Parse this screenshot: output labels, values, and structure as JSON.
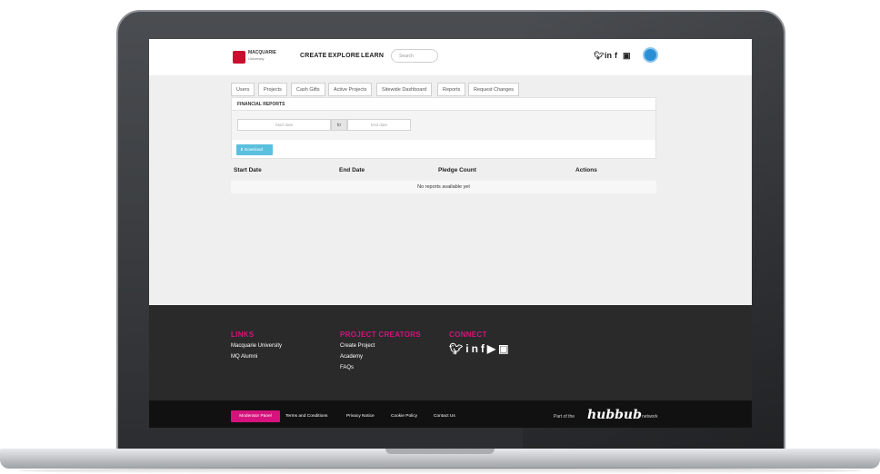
{
  "header": {
    "logo_name": "MACQUARIE",
    "logo_sub": "University",
    "nav": [
      "CREATE",
      "EXPLORE",
      "LEARN"
    ],
    "search_placeholder": "Search",
    "social_icons": [
      "twitter-icon",
      "linkedin-icon",
      "facebook-icon",
      "instagram-icon"
    ]
  },
  "tabs": [
    "Users",
    "Projects",
    "Cash Gifts",
    "Active Projects",
    "Sitewide Dashboard",
    "Reports",
    "Request Changes"
  ],
  "panel": {
    "title": "FINANCIAL REPORTS",
    "start_placeholder": "Start date",
    "to_label": "to",
    "end_placeholder": "End date",
    "download_label": "⬇ Download"
  },
  "table": {
    "headers": [
      "Start Date",
      "End Date",
      "Pledge Count",
      "Actions"
    ],
    "empty_message": "No reports available yet"
  },
  "footer": {
    "links_heading": "LINKS",
    "links": [
      "Macquarie University",
      "MQ Alumni"
    ],
    "creators_heading": "PROJECT CREATORS",
    "creators": [
      "Create Project",
      "Academy",
      "FAQs"
    ],
    "connect_heading": "CONNECT",
    "connect_icons": [
      "twitter-icon",
      "linkedin-icon",
      "facebook-icon",
      "youtube-icon",
      "instagram-icon"
    ]
  },
  "bottom": {
    "moderator": "Moderator Panel",
    "links": [
      "Terms and Conditions",
      "Privacy Notice",
      "Cookie Policy",
      "Contact Us"
    ],
    "part_of": "Part of the",
    "brand": "hubbub",
    "network": "network"
  },
  "colors": {
    "accent_pink": "#d6137d",
    "download_blue": "#5bc0de",
    "logo_red": "#c8102e"
  }
}
